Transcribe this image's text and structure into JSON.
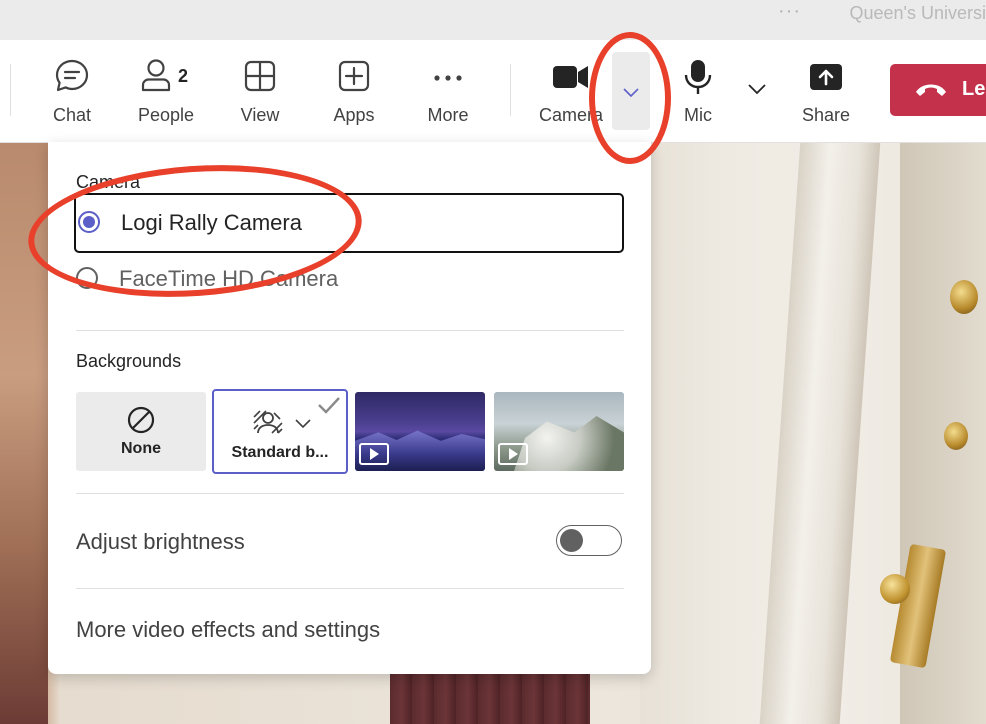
{
  "window": {
    "org_name": "Queen's Universi",
    "overflow_dots": "···"
  },
  "toolbar": {
    "chat": "Chat",
    "people": "People",
    "people_count": "2",
    "view": "View",
    "apps": "Apps",
    "more": "More",
    "camera": "Camera",
    "mic": "Mic",
    "share": "Share",
    "leave": "Le"
  },
  "camera_menu": {
    "title": "Camera",
    "devices": [
      {
        "label": "Logi Rally Camera",
        "selected": true
      },
      {
        "label": "FaceTime HD Camera",
        "selected": false
      }
    ],
    "backgrounds_title": "Backgrounds",
    "backgrounds": [
      {
        "label": "None",
        "selected": false
      },
      {
        "label": "Standard b...",
        "selected": true
      },
      {
        "label": "",
        "type": "video-night-mountains"
      },
      {
        "label": "",
        "type": "video-snowy-forest"
      }
    ],
    "adjust_brightness": "Adjust brightness",
    "adjust_brightness_on": false,
    "more_settings": "More video effects and settings"
  },
  "colors": {
    "accent": "#5b5fc7",
    "leave_red": "#c4314b",
    "annotation_red": "#e8402a"
  }
}
